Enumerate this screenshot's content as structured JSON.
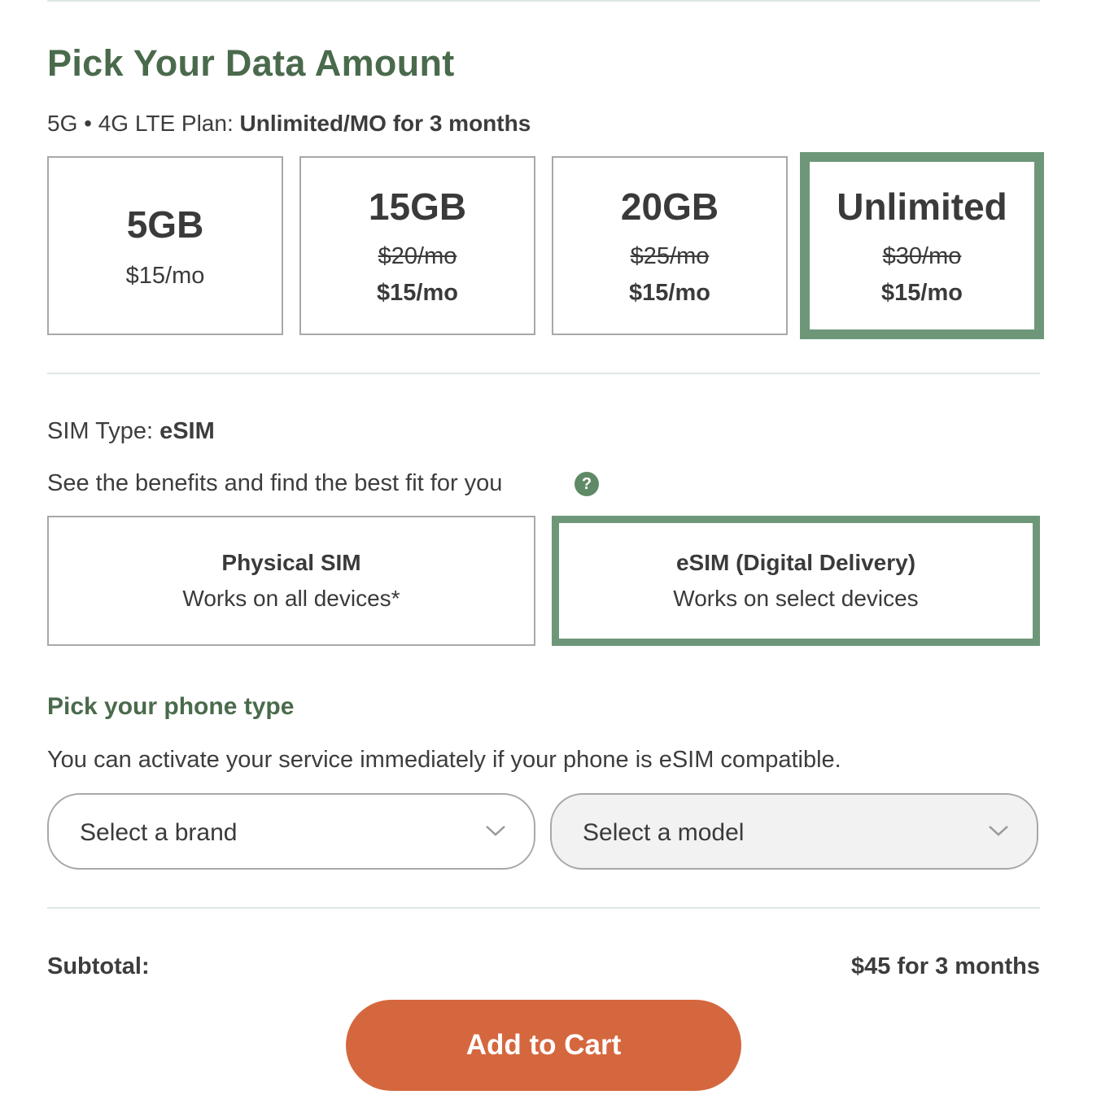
{
  "page_title": "Pick Your Data Amount",
  "plan": {
    "prefix": "5G • 4G LTE Plan: ",
    "value": "Unlimited/MO for 3 months"
  },
  "data_options": [
    {
      "amount": "5GB",
      "price": "$15/mo",
      "selected": false
    },
    {
      "amount": "15GB",
      "old_price": "$20/mo",
      "price": "$15/mo",
      "selected": false
    },
    {
      "amount": "20GB",
      "old_price": "$25/mo",
      "price": "$15/mo",
      "selected": false
    },
    {
      "amount": "Unlimited",
      "old_price": "$30/mo",
      "price": "$15/mo",
      "selected": true
    }
  ],
  "sim": {
    "type_label": "SIM Type: ",
    "type_value": "eSIM",
    "benefits_text": "See the benefits and find the best fit for you",
    "help_icon": "?",
    "options": [
      {
        "name": "Physical SIM",
        "sub": "Works on all devices*",
        "selected": false
      },
      {
        "name": "eSIM (Digital Delivery)",
        "sub": "Works on select devices",
        "selected": true
      }
    ]
  },
  "phone": {
    "heading": "Pick your phone type",
    "description": "You can activate your service immediately if your phone is eSIM compatible.",
    "brand_select": "Select a brand",
    "model_select": "Select a model"
  },
  "subtotal": {
    "label": "Subtotal:",
    "value": "$45 for 3 months"
  },
  "cart_button": "Add to Cart",
  "colors": {
    "accent_green": "#6e9779",
    "heading_green": "#4a6a4c",
    "button_orange": "#d5673e"
  }
}
